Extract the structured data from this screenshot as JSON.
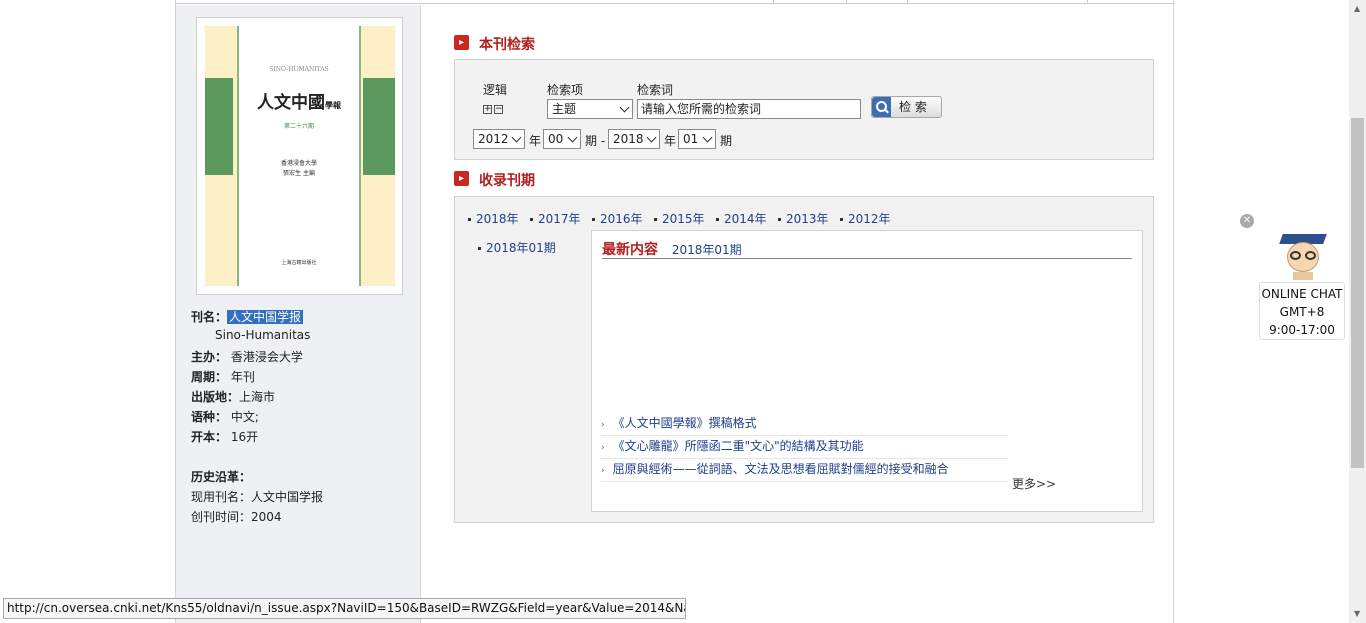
{
  "cover": {
    "en_title": "SINO-HUMANITAS",
    "cn_title": "人文中國",
    "cn_title_small": "學報",
    "issue": "第二十六期",
    "publisher_line1": "香港浸會大學",
    "publisher_line2": "張宏生 主編",
    "press": "上海古籍出版社"
  },
  "info": {
    "title_label": "刊名：",
    "title_value": "人文中国学报",
    "en_title": "Sino-Humanitas",
    "sponsor_label": "主办：",
    "sponsor_value": "香港浸会大学",
    "period_label": "周期：",
    "period_value": "年刊",
    "place_label": "出版地：",
    "place_value": "上海市",
    "lang_label": "语种：",
    "lang_value": "中文;",
    "format_label": "开本：",
    "format_value": "16开",
    "history_label": "历史沿革：",
    "current_name_label": "现用刊名：",
    "current_name_value": "人文中国学报",
    "founded_label": "创刊时间：",
    "founded_value": "2004"
  },
  "search": {
    "section_title": "本刊检索",
    "logic_label": "逻辑",
    "field_label": "检索项",
    "term_label": "检索词",
    "field_value": "主题",
    "term_placeholder": "请输入您所需的检索词",
    "button_label": "检 索",
    "from_year": "2012",
    "from_issue": "00",
    "to_year": "2018",
    "to_issue": "01",
    "year_unit": "年",
    "issue_unit": "期",
    "dash": "-"
  },
  "issues": {
    "section_title": "收录刊期",
    "years": [
      "2018年",
      "2017年",
      "2016年",
      "2015年",
      "2014年",
      "2013年",
      "2012年"
    ],
    "selected_issue": "2018年01期",
    "latest_title": "最新内容",
    "latest_issue": "2018年01期",
    "articles": [
      "《人文中國學報》撰稿格式",
      "《文心雕龍》所隱函二重\"文心\"的結構及其功能",
      "屈原與經術——從詞語、文法及思想看屈賦對儒經的接受和融合"
    ],
    "more": "更多>>"
  },
  "float": {
    "line1": "ONLINE CHAT",
    "line2": "GMT+8",
    "line3": "9:00-17:00"
  },
  "status_url": "http://cn.oversea.cnki.net/Kns55/oldnavi/n_issue.aspx?NaviID=150&BaseID=RWZG&Field=year&Value=2014&NaviLink=%e4%b"
}
